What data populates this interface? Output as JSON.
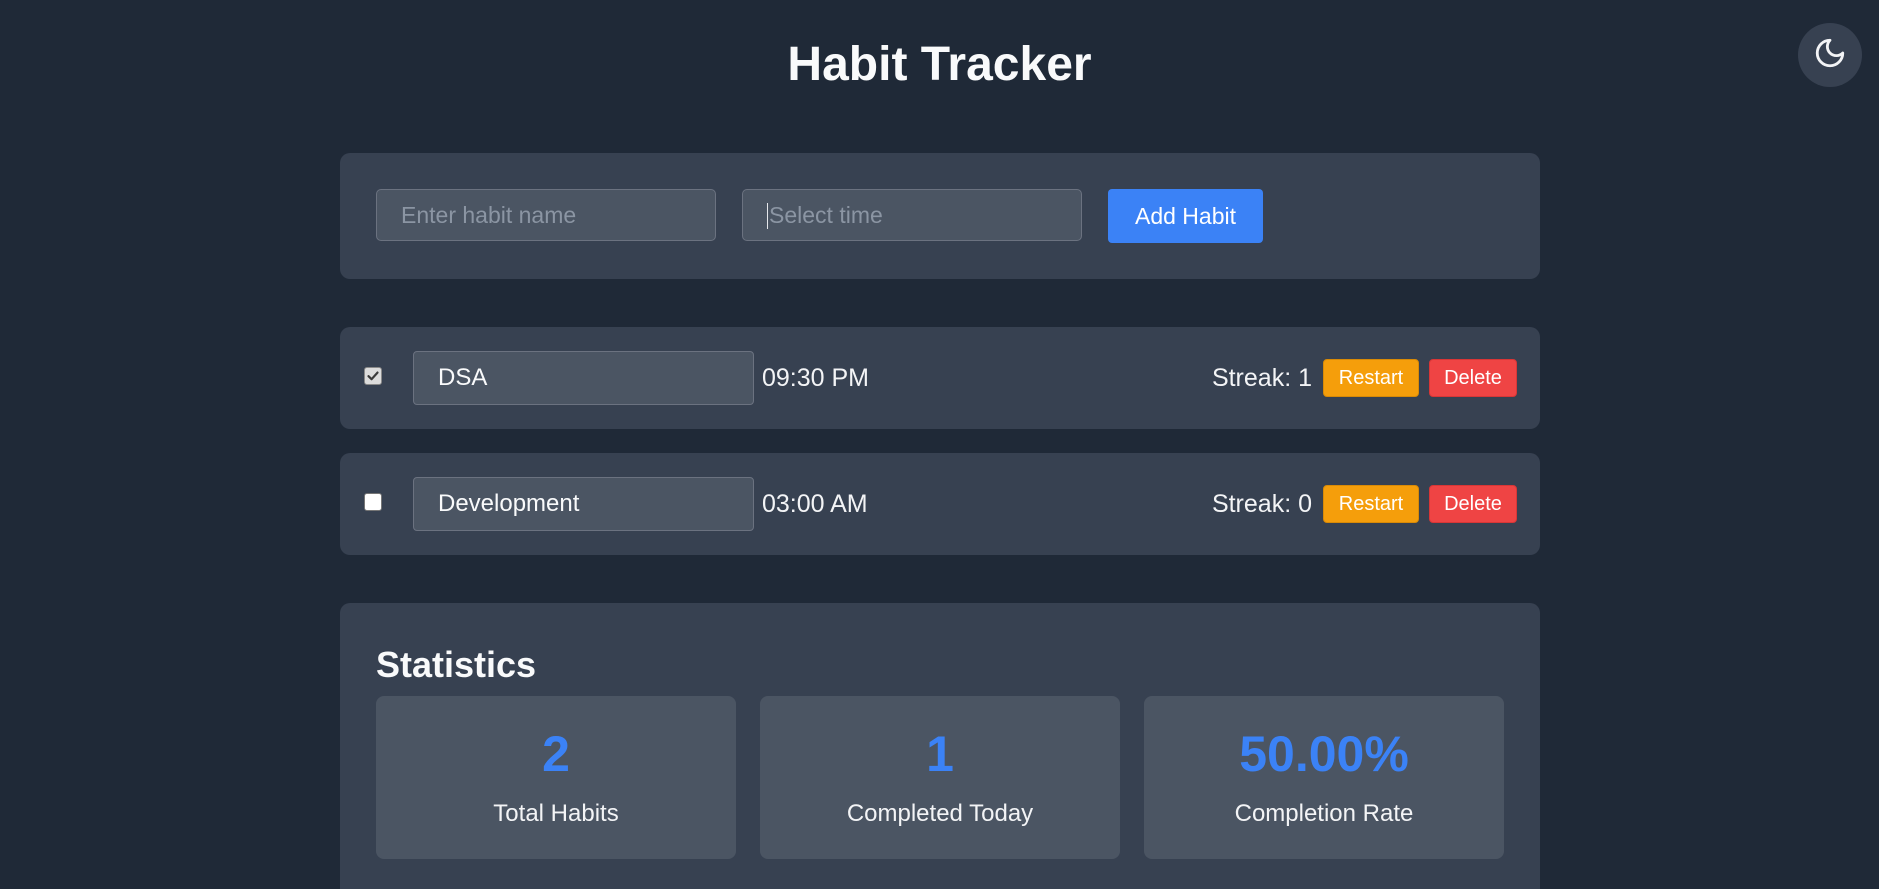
{
  "app": {
    "title": "Habit Tracker",
    "theme_toggle_icon": "moon-icon"
  },
  "add_form": {
    "habit_name_value": "",
    "habit_name_placeholder": "Enter habit name",
    "time_value": "",
    "time_placeholder": "Select time",
    "add_button_label": "Add Habit"
  },
  "habits": [
    {
      "completed": true,
      "name": "DSA",
      "time": "09:30 PM",
      "streak_text": "Streak: 1",
      "restart_label": "Restart",
      "delete_label": "Delete"
    },
    {
      "completed": false,
      "name": "Development",
      "time": "03:00 AM",
      "streak_text": "Streak: 0",
      "restart_label": "Restart",
      "delete_label": "Delete"
    }
  ],
  "statistics": {
    "title": "Statistics",
    "items": [
      {
        "value": "2",
        "label": "Total Habits"
      },
      {
        "value": "1",
        "label": "Completed Today"
      },
      {
        "value": "50.00%",
        "label": "Completion Rate"
      }
    ]
  },
  "colors": {
    "background": "#1f2937",
    "card": "#374151",
    "input": "#4b5563",
    "accent": "#3b82f6",
    "restart": "#f59e0b",
    "delete": "#ef4444"
  }
}
